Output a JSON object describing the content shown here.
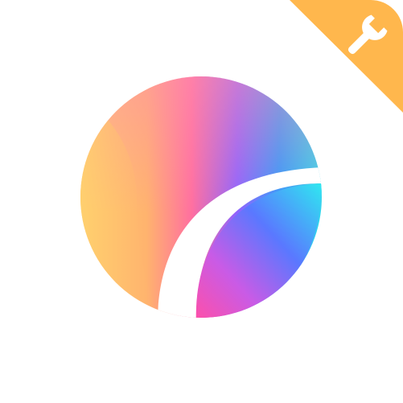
{
  "app_icon": {
    "name": "gradient-circle-logo",
    "badge_icon": "wrench-icon",
    "colors": {
      "background": "#ffffff",
      "badge": "#FFB74D",
      "badge_glyph": "#ffffff",
      "gradient_yellow": "#FFD36E",
      "gradient_orange": "#FF9C7A",
      "gradient_pink": "#FF5FA6",
      "gradient_purple": "#7A5CFF",
      "gradient_blue": "#2F9BFF",
      "gradient_cyan": "#2FF1E6"
    }
  }
}
